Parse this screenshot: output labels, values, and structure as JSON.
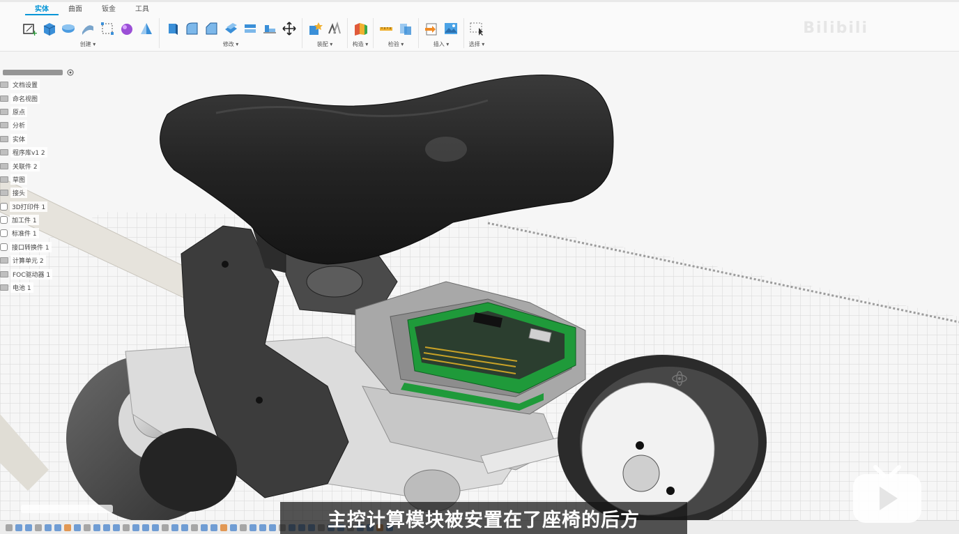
{
  "toolbar": {
    "tabs": [
      "实体",
      "曲面",
      "钣金",
      "工具"
    ],
    "groups": [
      {
        "label": "创建 ▾",
        "icons": [
          "sketch-plus-icon",
          "extrude-box-icon",
          "revolve-icon",
          "sweep-icon",
          "rectangle-pattern-icon",
          "form-sphere-icon",
          "mirror-triangle-icon"
        ]
      },
      {
        "label": "修改 ▾",
        "icons": [
          "press-pull-icon",
          "fillet-icon",
          "chamfer-icon",
          "shell-icon",
          "combine-icon",
          "align-icon",
          "move-icon"
        ]
      },
      {
        "label": "装配 ▾",
        "icons": [
          "new-component-icon",
          "joint-icon"
        ]
      },
      {
        "label": "构造 ▾",
        "icons": [
          "construction-plane-icon"
        ]
      },
      {
        "label": "检验 ▾",
        "icons": [
          "measure-icon",
          "interference-icon"
        ]
      },
      {
        "label": "插入 ▾",
        "icons": [
          "insert-derive-icon",
          "insert-image-icon"
        ]
      },
      {
        "label": "选择 ▾",
        "icons": [
          "select-cursor-icon"
        ]
      }
    ],
    "brand_faint": "Bilibili"
  },
  "browser": {
    "nodes": [
      {
        "label": "文档设置",
        "kind": "chip"
      },
      {
        "label": "命名视图",
        "kind": "chip"
      },
      {
        "label": "原点",
        "kind": "chip"
      },
      {
        "label": "分析",
        "kind": "chip"
      },
      {
        "label": "实体",
        "kind": "chip"
      },
      {
        "label": "程序库v1 2",
        "kind": "chip"
      },
      {
        "label": "关联件 2",
        "kind": "chip"
      },
      {
        "label": "草图",
        "kind": "chip"
      },
      {
        "label": "接头",
        "kind": "chip"
      },
      {
        "label": "3D打印件 1",
        "kind": "comp"
      },
      {
        "label": "加工件 1",
        "kind": "comp"
      },
      {
        "label": "标准件 1",
        "kind": "comp"
      },
      {
        "label": "接口转换件 1",
        "kind": "comp"
      },
      {
        "label": "计算单元 2",
        "kind": "chip"
      },
      {
        "label": "FOC驱动器 1",
        "kind": "chip"
      },
      {
        "label": "电池 1",
        "kind": "chip"
      }
    ]
  },
  "subtitle": "主控计算模块被安置在了座椅的后方",
  "colors": {
    "accent": "#0696d7",
    "pcb": "#1f9a3a",
    "subtitle_bg": "#141414"
  }
}
